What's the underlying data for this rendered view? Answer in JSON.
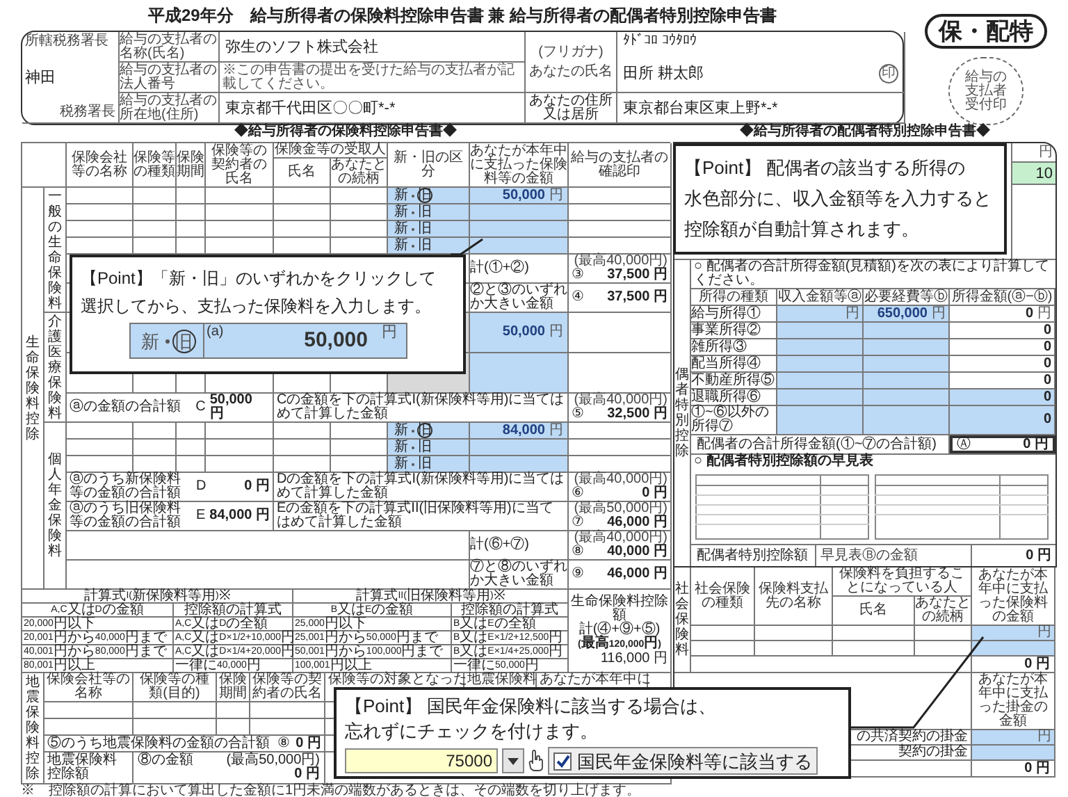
{
  "title": "平成29年分　給与所得者の保険料控除申告書 兼 給与所得者の配偶者特別控除申告書",
  "stamp": {
    "label": "保・配特",
    "seal_text": "給与の支払者受付印"
  },
  "employer": {
    "office_label": "所轄税務署長",
    "office": "神田",
    "office_suffix": "税務署長",
    "fields": [
      {
        "label": "給与の支払者の名称(氏名)",
        "value": "弥生のソフト株式会社"
      },
      {
        "label": "給与の支払者の法人番号",
        "note": "※この申告書の提出を受けた給与の支払者が記載してください。"
      },
      {
        "label": "給与の支払者の所在地(住所)",
        "value": "東京都千代田区〇〇町*-*"
      }
    ]
  },
  "employee": {
    "kana_label": "(フリガナ)",
    "name_label": "あなたの氏名",
    "kana": "ﾀﾄﾞｺﾛ ｺｳﾀﾛｳ",
    "name": "田所 耕太郎",
    "seal": "印",
    "address_label": "あなたの住所又は居所",
    "address": "東京都台東区東上野*-*"
  },
  "insurance_heading": "◆給与所得者の保険料控除申告書◆",
  "spouse_heading": "◆給与所得者の配偶者特別控除申告書◆",
  "life_insurance": {
    "category": "生命保険料控除",
    "columns": [
      "保険会社等の名称",
      "保険等の種類",
      "保険期間",
      "保険等の契約者の氏名",
      "保険金等の受取人",
      "氏名",
      "あなたとの続柄",
      "新・旧の区分",
      "あなたが本年中に支払った保険料等の金額",
      "給与の支払者の確認印"
    ],
    "general": {
      "label": "一般の生命保険料",
      "rows": [
        {
          "era": [
            {
              "label": "新",
              "selected": false
            },
            {
              "label": "旧",
              "selected": true
            }
          ],
          "amount": "50,000",
          "unit": "円"
        },
        {
          "era": [
            {
              "label": "新",
              "selected": false
            },
            {
              "label": "旧",
              "selected": false
            }
          ]
        },
        {
          "era": [
            {
              "label": "新",
              "selected": false
            },
            {
              "label": "旧",
              "selected": false
            }
          ]
        },
        {
          "era": [
            {
              "label": "新",
              "selected": false
            },
            {
              "label": "旧",
              "selected": false
            }
          ]
        }
      ],
      "subtotals": [
        {
          "label": "計(①+②)",
          "num": "③",
          "note": "(最高40,000円)",
          "value": "37,500",
          "unit": "円"
        },
        {
          "label": "②と③のいずれか大きい金額",
          "num": "④",
          "value": "37,500",
          "unit": "円"
        }
      ]
    },
    "care": {
      "label": "介護医療保険料",
      "rows": [
        {
          "amount": "50,000",
          "unit": "円"
        },
        {}
      ],
      "total": {
        "label": "ⓐの金額の合計額",
        "letter": "C",
        "value": "50,000",
        "unit": "円"
      },
      "calc": {
        "label": "Cの金額を下の計算式I(新保険料等用)に当てはめて計算した金額",
        "num": "⑤",
        "note": "(最高40,000円)",
        "value": "32,500",
        "unit": "円"
      }
    },
    "pension": {
      "label": "個人年金保険料",
      "rows": [
        {
          "era": [
            {
              "label": "新",
              "selected": false
            },
            {
              "label": "旧",
              "selected": true
            }
          ],
          "amount": "84,000",
          "unit": "円"
        },
        {
          "era": [
            {
              "label": "新",
              "selected": false
            },
            {
              "label": "旧",
              "selected": false
            }
          ]
        },
        {
          "era": [
            {
              "label": "新",
              "selected": false
            },
            {
              "label": "旧",
              "selected": false
            }
          ]
        }
      ],
      "new_total": {
        "label": "ⓐのうち新保険料等の金額の合計額",
        "letter": "D",
        "value": "0",
        "unit": "円"
      },
      "new_calc": {
        "label": "Dの金額を下の計算式I(新保険料等用)に当てはめて計算した金額",
        "num": "⑥",
        "note": "(最高40,000円)",
        "value": "0",
        "unit": "円"
      },
      "old_total": {
        "label": "ⓐのうち旧保険料等の金額の合計額",
        "letter": "E",
        "value": "84,000",
        "unit": "円"
      },
      "old_calc": {
        "label": "Eの金額を下の計算式II(旧保険料等用)に当てはめて計算した金額",
        "num": "⑦",
        "note": "(最高50,000円)",
        "value": "46,000",
        "unit": "円"
      },
      "subtotals": [
        {
          "label": "計(⑥+⑦)",
          "num": "⑧",
          "note": "(最高40,000円)",
          "value": "40,000",
          "unit": "円"
        },
        {
          "label": "⑦と⑧のいずれか大きい金額",
          "num": "⑨",
          "value": "46,000",
          "unit": "円"
        }
      ]
    }
  },
  "calc_table": {
    "headers": [
      "計算式I(新保険料等用)※",
      "計算式II(旧保険料等用)※"
    ],
    "columns": [
      "A,C又はDの金額",
      "控除額の計算式",
      "B又はEの金額",
      "控除額の計算式"
    ],
    "rows": [
      [
        "20,000円以下",
        "A,C又はDの全額",
        "25,000円以下",
        "B又はEの全額"
      ],
      [
        "20,001円から40,000円まで",
        "A,C又はD×1/2+10,000円",
        "25,001円から50,000円まで",
        "B又はE×1/2+12,500円"
      ],
      [
        "40,001円から80,000円まで",
        "A,C又はD×1/4+20,000円",
        "50,001円から100,000円まで",
        "B又はE×1/4+25,000円"
      ],
      [
        "80,001円以上",
        "一律に40,000円",
        "100,001円以上",
        "一律に50,000円"
      ]
    ],
    "total": {
      "label": "生命保険料控除額",
      "formula": "計(④+⑨+⑤)",
      "note": "(最高120,000円)",
      "value": "116,000",
      "unit": "円"
    }
  },
  "earthquake": {
    "label": "地震保険料控除",
    "columns": [
      "保険会社等の名称",
      "保険等の種類(目的)",
      "保険期間",
      "保険等の契約者の氏名",
      "保険等の対象となった",
      "地震保険料",
      "あなたが本年中に"
    ],
    "total": {
      "label": "⑤のうち地震保険料の金額の合計額",
      "num": "⑧",
      "value": "0",
      "unit": "円"
    },
    "deduction": {
      "label": "地震保険料控除額",
      "sub": "⑧の金額",
      "note": "(最高50,000円)",
      "value": "0",
      "unit": "円"
    }
  },
  "spouse": {
    "top_unit": "円",
    "top_value": "10",
    "side_label": "偶者特別控除",
    "instruction": "○ 配偶者の合計所得金額(見積額)を次の表により計算してください。",
    "columns": [
      "所得の種類",
      "収入金額等ⓐ",
      "必要経費等ⓑ",
      "所得金額(ⓐ−ⓑ)"
    ],
    "rows": [
      {
        "label": "給与所得①",
        "income_unit": "円",
        "expense": "650,000",
        "expense_unit": "円",
        "amount": "0",
        "amount_unit": "円",
        "amount_editable": false
      },
      {
        "label": "事業所得②",
        "amount": "0",
        "amount_editable": false
      },
      {
        "label": "雑所得③",
        "amount": "0",
        "amount_editable": false
      },
      {
        "label": "配当所得④",
        "amount": "0",
        "amount_editable": false
      },
      {
        "label": "不動産所得⑤",
        "amount": "0",
        "amount_editable": false
      },
      {
        "label": "退職所得⑥",
        "amount": "0",
        "amount_editable": true
      },
      {
        "label": "①~⑥以外の所得⑦",
        "amount": "0",
        "amount_editable": true
      }
    ],
    "total": {
      "label": "配偶者の合計所得金額(①~⑦の合計額)",
      "letter": "Ⓐ",
      "value": "0",
      "unit": "円"
    },
    "quick_heading": "○ 配偶者特別控除額の早見表",
    "deduction": {
      "label": "配偶者特別控除額",
      "sub": "早見表Ⓑの金額",
      "value": "0",
      "unit": "円"
    }
  },
  "social_insurance": {
    "side_label": "社会保険料",
    "columns": [
      "社会保険の種類",
      "保険料支払先の名称",
      "保険料を負担することになっている人",
      "氏名",
      "あなたとの続柄",
      "あなたが本年中に支払った保険料の金額"
    ],
    "unit": "円",
    "total": "0",
    "total_unit": "円"
  },
  "small_business": {
    "column": "あなたが本年中に支払った掛金の金額",
    "rows": [
      {
        "label": "の共済契約の掛金",
        "unit": "円"
      },
      {
        "label": "契約の掛金"
      }
    ],
    "total": "0",
    "total_unit": "円"
  },
  "footnote": "※　控除額の計算において算出した金額に1円未満の端数があるときは、その端数を切り上げます。",
  "callout_era": {
    "lines": [
      "【Point】「新・旧」のいずれかをクリックして",
      "選択してから、支払った保険料を入力します。"
    ],
    "sample": {
      "era": [
        {
          "label": "新",
          "selected": false
        },
        {
          "label": "旧",
          "selected": true
        }
      ],
      "mark": "(a)",
      "amount": "50,000",
      "unit": "円"
    }
  },
  "callout_spouse": {
    "lines": [
      "【Point】 配偶者の該当する所得の",
      "水色部分に、収入金額等を入力すると",
      "控除額が自動計算されます。"
    ]
  },
  "callout_pension": {
    "lines": [
      "【Point】 国民年金保険料に該当する場合は、",
      "忘れずにチェックを付けます。"
    ],
    "input": {
      "value": "75000"
    },
    "checkbox": {
      "label": "国民年金保険料等に該当する",
      "checked": true
    }
  }
}
